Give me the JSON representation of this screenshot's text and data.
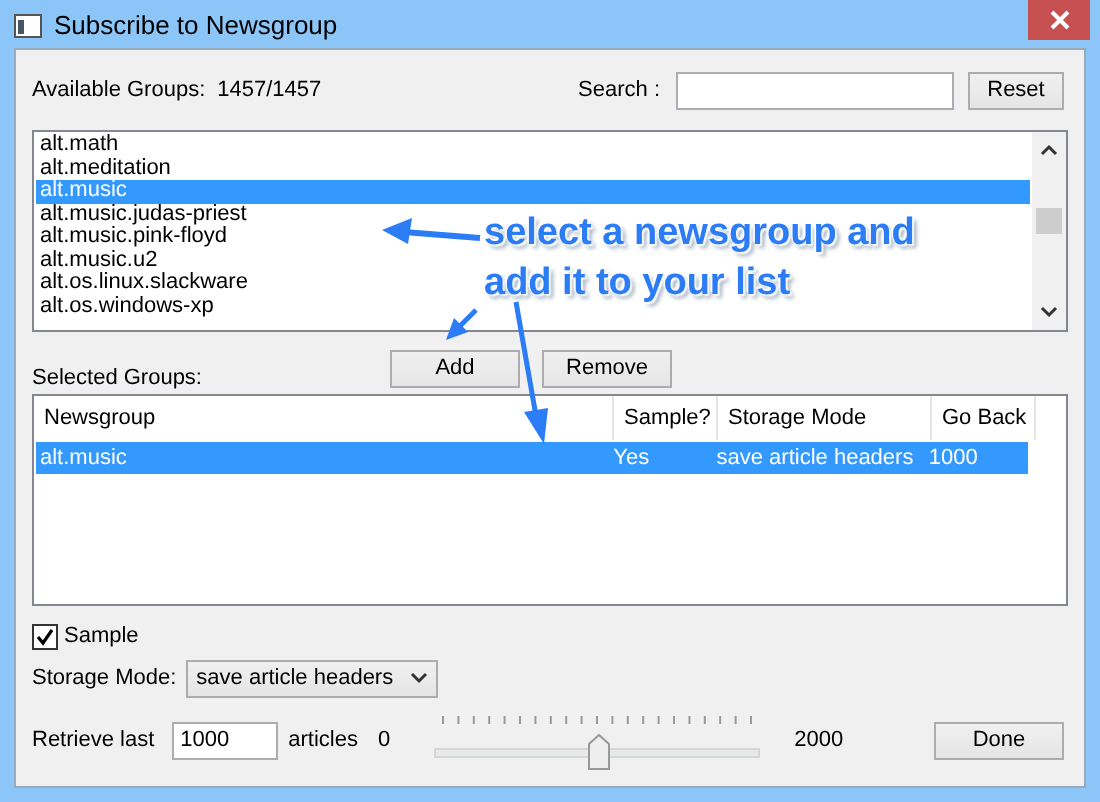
{
  "window": {
    "title": "Subscribe to Newsgroup"
  },
  "available_groups": {
    "label": "Available Groups:",
    "count": "1457/1457"
  },
  "search": {
    "label": "Search :"
  },
  "reset_button": "Reset",
  "groups": [
    {
      "name": "alt.math",
      "selected": false
    },
    {
      "name": "alt.meditation",
      "selected": false
    },
    {
      "name": "alt.music",
      "selected": true
    },
    {
      "name": "alt.music.judas-priest",
      "selected": false
    },
    {
      "name": "alt.music.pink-floyd",
      "selected": false
    },
    {
      "name": "alt.music.u2",
      "selected": false
    },
    {
      "name": "alt.os.linux.slackware",
      "selected": false
    },
    {
      "name": "alt.os.windows-xp",
      "selected": false
    }
  ],
  "buttons": [
    "Add",
    "Remove"
  ],
  "selected_groups": {
    "label": "Selected Groups:",
    "columns": [
      "Newsgroup",
      "Sample?",
      "Storage Mode",
      "Go Back"
    ],
    "rows": [
      {
        "cells": [
          "alt.music",
          "Yes",
          "save article headers",
          "1000"
        ],
        "selected": true
      }
    ]
  },
  "sample": {
    "label": "Sample",
    "checked": true
  },
  "storage_mode": {
    "label": "Storage Mode:",
    "value": "save article headers"
  },
  "retrieve": {
    "label": "Retrieve last",
    "value": "1000",
    "unit": "articles",
    "min": "0",
    "max": "2000",
    "level": 0.5
  },
  "done_button": "Done",
  "annotation": {
    "lines": [
      "select a newsgroup and",
      "add it to your list"
    ]
  }
}
